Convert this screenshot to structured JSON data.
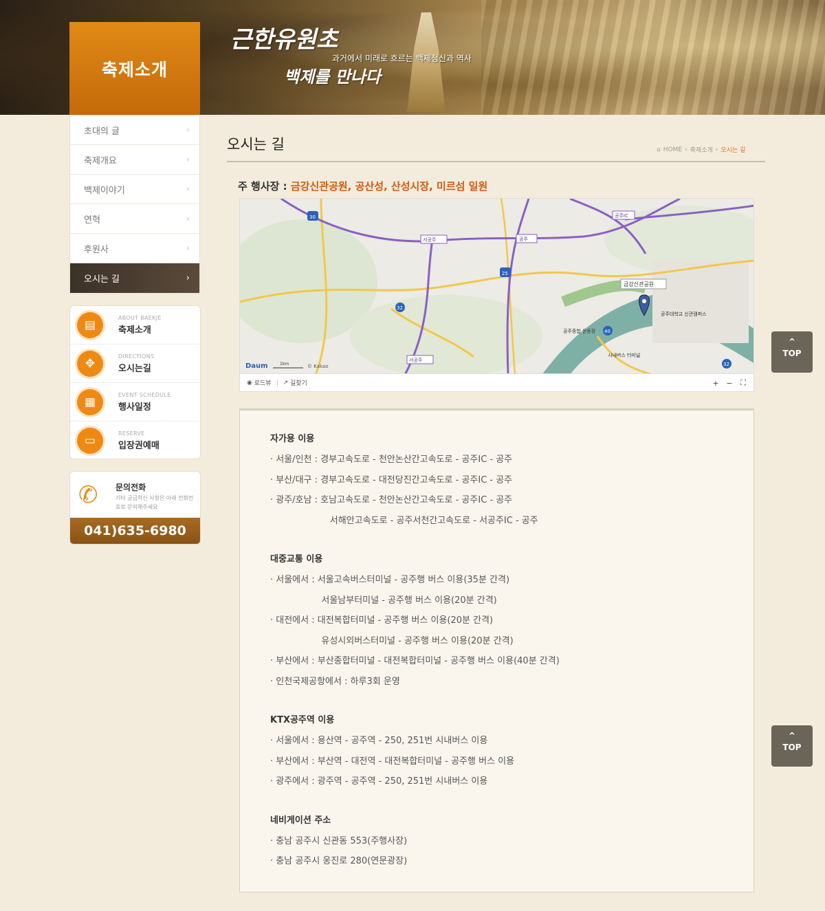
{
  "header": {
    "section_title": "축제소개",
    "logo_line1": "근한유원초",
    "logo_tagline": "과거에서 미래로 흐르는 백제정신과 역사",
    "logo_line2": "백제를 만나다"
  },
  "sidebar": {
    "items": [
      {
        "label": "초대의 글"
      },
      {
        "label": "축제개요"
      },
      {
        "label": "백제이야기"
      },
      {
        "label": "연혁"
      },
      {
        "label": "후원사"
      },
      {
        "label": "오시는 길"
      }
    ],
    "active_index": 5
  },
  "quick_menu": [
    {
      "en": "ABOUT BAEKJE",
      "ko": "축제소개",
      "icon": "document-icon"
    },
    {
      "en": "DIRECTIONS",
      "ko": "오시는길",
      "icon": "compass-icon"
    },
    {
      "en": "EVENT SCHEDULE",
      "ko": "행사일정",
      "icon": "calendar-icon"
    },
    {
      "en": "RESERVE",
      "ko": "입장권예매",
      "icon": "ticket-icon"
    }
  ],
  "contact": {
    "title": "문의전화",
    "desc": "기타 궁금하신 사항은 아래 전화번호로 문의해주세요",
    "number": "041)635-6980"
  },
  "main": {
    "page_title": "오시는 길",
    "breadcrumb": [
      "HOME",
      "축제소개",
      "오시는 길"
    ],
    "venue_label": "주 행사장 : ",
    "venue_value": "금강신관공원, 공산성, 산성시장, 미르섬 일원"
  },
  "map": {
    "labels": {
      "place1": "금강신관공원",
      "place2": "공주대학교 신관캠퍼스",
      "place3": "공주종합 운동장",
      "place4": "시내버스 터미널",
      "ic1": "서공주",
      "ic2": "공주",
      "ic3": "공주IC",
      "ic4": "서공주",
      "rt1": "30",
      "rt2": "25",
      "rt3": "32",
      "rt4": "40",
      "rt5": "32"
    },
    "brand": "Daum",
    "scale": "1km",
    "copyright": "© Kakao",
    "roadview": "로드뷰",
    "directions": "길찾기",
    "zoom_in": "+",
    "zoom_out": "−",
    "fullscreen": "⛶"
  },
  "directions": {
    "sections": [
      {
        "title": "자가용 이용",
        "lines": [
          "· 서울/인천 : 경부고속도로 - 천안논산간고속도로 - 공주IC - 공주",
          "· 부산/대구 : 경부고속도로 - 대전당진간고속도로 - 공주IC - 공주",
          "· 광주/호남 : 호남고속도로 - 천안논산간고속도로 - 공주IC - 공주",
          "                     서해안고속도로 - 공주서천간고속도로 - 서공주IC - 공주"
        ]
      },
      {
        "title": "대중교통 이용",
        "lines": [
          "· 서울에서 : 서울고속버스터미널 - 공주행 버스 이용(35분 간격)",
          "                  서울남부터미널 - 공주행 버스 이용(20분 간격)",
          "· 대전에서 : 대전복합터미널 - 공주행 버스 이용(20분 간격)",
          "                  유성시외버스터미널 - 공주행 버스 이용(20분 간격)",
          "· 부산에서 : 부산종합터미널 - 대전복합터미널 - 공주행 버스 이용(40분 간격)",
          "· 인천국제공항에서 : 하루3회 운영"
        ]
      },
      {
        "title": "KTX공주역 이용",
        "lines": [
          "· 서울에서 : 용산역 - 공주역 - 250, 251번 시내버스 이용",
          "· 부산에서 : 부산역 - 대전역 - 대전복합터미널 - 공주행 버스 이용",
          "· 광주에서 : 광주역 - 공주역 - 250, 251번 시내버스 이용"
        ]
      },
      {
        "title": "네비게이션 주소",
        "lines": [
          "· 충남 공주시 신관동 553(주행사장)",
          "· 충남 공주시 웅진로 280(연문광장)"
        ]
      }
    ]
  },
  "top_button": {
    "arrow": "^",
    "label": "TOP"
  },
  "colors": {
    "accent_orange": "#e0801a",
    "venue_highlight": "#d25a0f",
    "active_nav": "#4a3e32",
    "contact_bar": "#9a5e1a"
  }
}
